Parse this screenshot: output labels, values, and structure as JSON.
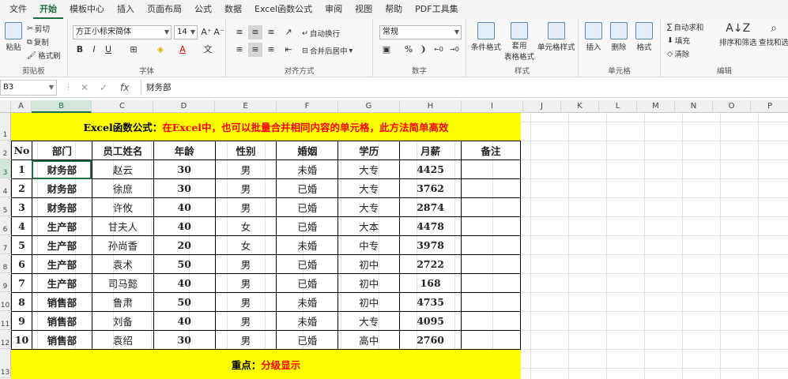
{
  "menu": [
    "文件",
    "开始",
    "模板中心",
    "插入",
    "页面布局",
    "公式",
    "数据",
    "Excel函数公式",
    "审阅",
    "视图",
    "帮助",
    "PDF工具集"
  ],
  "active_menu": "开始",
  "ribbon": {
    "clipboard": {
      "paste": "粘贴",
      "cut": "剪切",
      "copy": "复制",
      "painter": "格式刷",
      "label": "剪贴板"
    },
    "font": {
      "name": "方正小标宋简体",
      "size": "14",
      "grow": "A⁺",
      "shrink": "A⁻",
      "bold": "B",
      "italic": "I",
      "underline": "U",
      "label": "字体"
    },
    "alignment": {
      "wrap": "自动换行",
      "merge": "合并后居中",
      "label": "对齐方式"
    },
    "number": {
      "format": "常规",
      "label": "数字"
    },
    "styles": {
      "conditional": "条件格式",
      "table_format_1": "套用",
      "table_format_2": "表格格式",
      "cell_style": "单元格样式",
      "label": "样式"
    },
    "cells": {
      "insert": "插入",
      "delete": "删除",
      "format": "格式",
      "label": "单元格"
    },
    "editing": {
      "autosum": "自动求和",
      "fill": "填充",
      "clear": "清除",
      "sort": "排序和筛选",
      "find": "查找和选",
      "label": "编辑"
    }
  },
  "formula_bar": {
    "cell_ref": "B3",
    "cancel": "✕",
    "enter": "✓",
    "fx": "fx",
    "content": "财务部"
  },
  "columns": [
    "A",
    "B",
    "C",
    "D",
    "E",
    "F",
    "G",
    "H",
    "I",
    "J",
    "K",
    "L",
    "M",
    "N",
    "O",
    "P"
  ],
  "rows": [
    "1",
    "2",
    "3",
    "4",
    "5",
    "6",
    "7",
    "8",
    "9",
    "10",
    "11",
    "12",
    "13"
  ],
  "selected_column": "B",
  "selected_row": "3",
  "banner_top": {
    "key": "Excel函数公式：",
    "value": "在Excel中，也可以批量合并相同内容的单元格，此方法简单高效"
  },
  "banner_bottom": {
    "key": "重点：",
    "value": "分级显示"
  },
  "table": {
    "headers": [
      "No",
      "部门",
      "员工姓名",
      "年龄",
      "性别",
      "婚姻",
      "学历",
      "月薪",
      "备注"
    ],
    "rows": [
      [
        "1",
        "财务部",
        "赵云",
        "30",
        "男",
        "未婚",
        "大专",
        "4425",
        ""
      ],
      [
        "2",
        "财务部",
        "徐庶",
        "30",
        "男",
        "已婚",
        "大专",
        "3762",
        ""
      ],
      [
        "3",
        "财务部",
        "许攸",
        "40",
        "男",
        "已婚",
        "大专",
        "2874",
        ""
      ],
      [
        "4",
        "生产部",
        "甘夫人",
        "40",
        "女",
        "已婚",
        "大本",
        "4478",
        ""
      ],
      [
        "5",
        "生产部",
        "孙尚香",
        "20",
        "女",
        "未婚",
        "中专",
        "3978",
        ""
      ],
      [
        "6",
        "生产部",
        "袁术",
        "50",
        "男",
        "已婚",
        "初中",
        "2722",
        ""
      ],
      [
        "7",
        "生产部",
        "司马懿",
        "40",
        "男",
        "已婚",
        "初中",
        "168",
        ""
      ],
      [
        "8",
        "销售部",
        "鲁肃",
        "50",
        "男",
        "未婚",
        "初中",
        "4735",
        ""
      ],
      [
        "9",
        "销售部",
        "刘备",
        "40",
        "男",
        "未婚",
        "大专",
        "4095",
        ""
      ],
      [
        "10",
        "销售部",
        "袁绍",
        "30",
        "男",
        "已婚",
        "高中",
        "2760",
        ""
      ]
    ]
  }
}
